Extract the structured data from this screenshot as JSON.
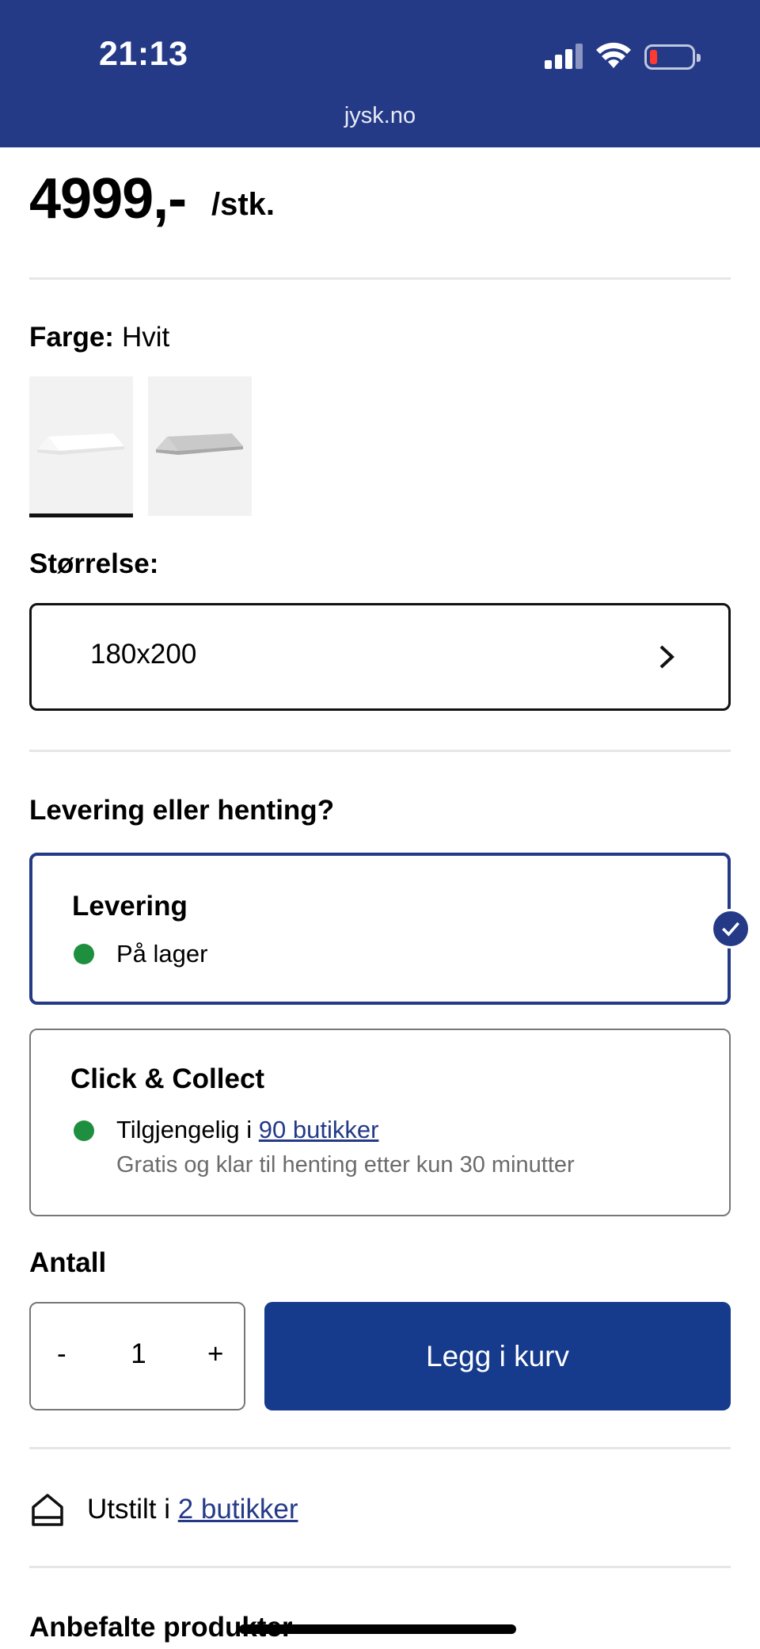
{
  "status_bar": {
    "time": "21:13",
    "url": "jysk.no",
    "bg_color": "#243a87"
  },
  "product": {
    "price": "4999,-",
    "unit": "/stk."
  },
  "color": {
    "label": "Farge:",
    "value": "Hvit",
    "swatches": [
      {
        "name": "Hvit",
        "selected": true
      },
      {
        "name": "Grå",
        "selected": false
      }
    ]
  },
  "size": {
    "label": "Størrelse:",
    "value": "180x200"
  },
  "delivery": {
    "heading": "Levering eller henting?",
    "options": [
      {
        "title": "Levering",
        "status": "På lager",
        "selected": true
      },
      {
        "title": "Click & Collect",
        "status_prefix": "Tilgjengelig i ",
        "status_link": "90 butikker",
        "note": "Gratis og klar til henting etter kun 30 minutter",
        "selected": false
      }
    ]
  },
  "quantity": {
    "label": "Antall",
    "minus": "-",
    "value": "1",
    "plus": "+"
  },
  "cart": {
    "button_label": "Legg i kurv",
    "color": "#163b8c"
  },
  "stores": {
    "prefix": "Utstilt i ",
    "link": "2 butikker"
  },
  "recommended": {
    "heading": "Anbefalte produkter"
  },
  "colors": {
    "accent": "#243a87",
    "in_stock": "#1e8f3e"
  }
}
